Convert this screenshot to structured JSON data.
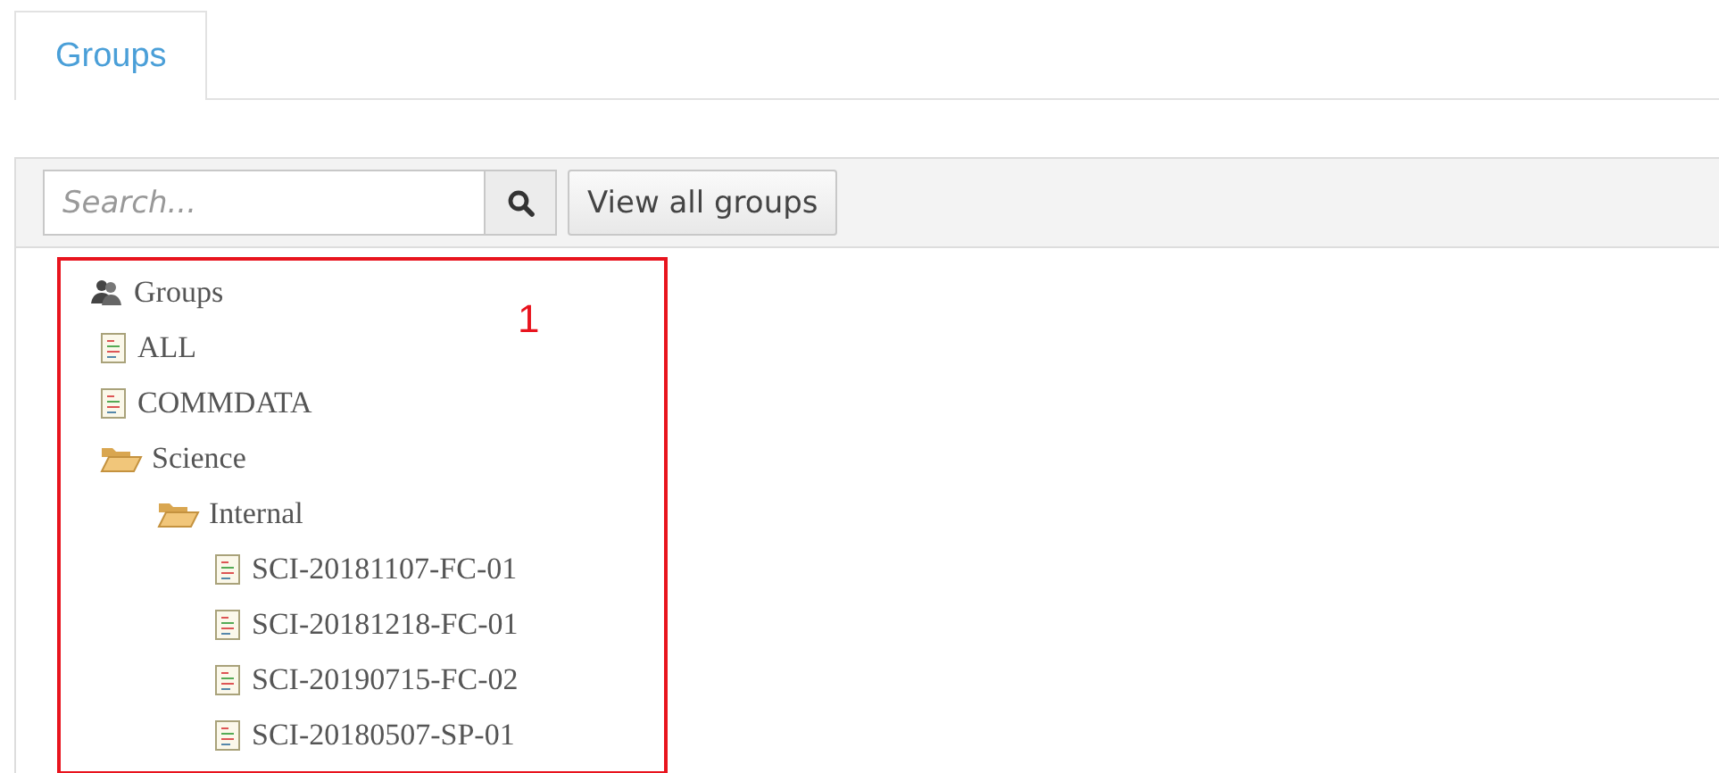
{
  "tabs": [
    {
      "label": "Groups",
      "selected": true
    }
  ],
  "toolbar": {
    "search": {
      "placeholder": "Search..."
    },
    "view_all_button": "View all groups"
  },
  "annotation": {
    "label": "1"
  },
  "tree": [
    {
      "label": "Groups",
      "kind": "root",
      "children": [
        {
          "label": "ALL",
          "kind": "group"
        },
        {
          "label": "COMMDATA",
          "kind": "group"
        },
        {
          "label": "Science",
          "kind": "folder",
          "expanded": true,
          "children": [
            {
              "label": "Internal",
              "kind": "folder",
              "expanded": true,
              "children": [
                {
                  "label": "SCI-20181107-FC-01",
                  "kind": "group"
                },
                {
                  "label": "SCI-20181218-FC-01",
                  "kind": "group"
                },
                {
                  "label": "SCI-20190715-FC-02",
                  "kind": "group"
                },
                {
                  "label": "SCI-20180507-SP-01",
                  "kind": "group"
                }
              ]
            }
          ]
        }
      ]
    }
  ]
}
